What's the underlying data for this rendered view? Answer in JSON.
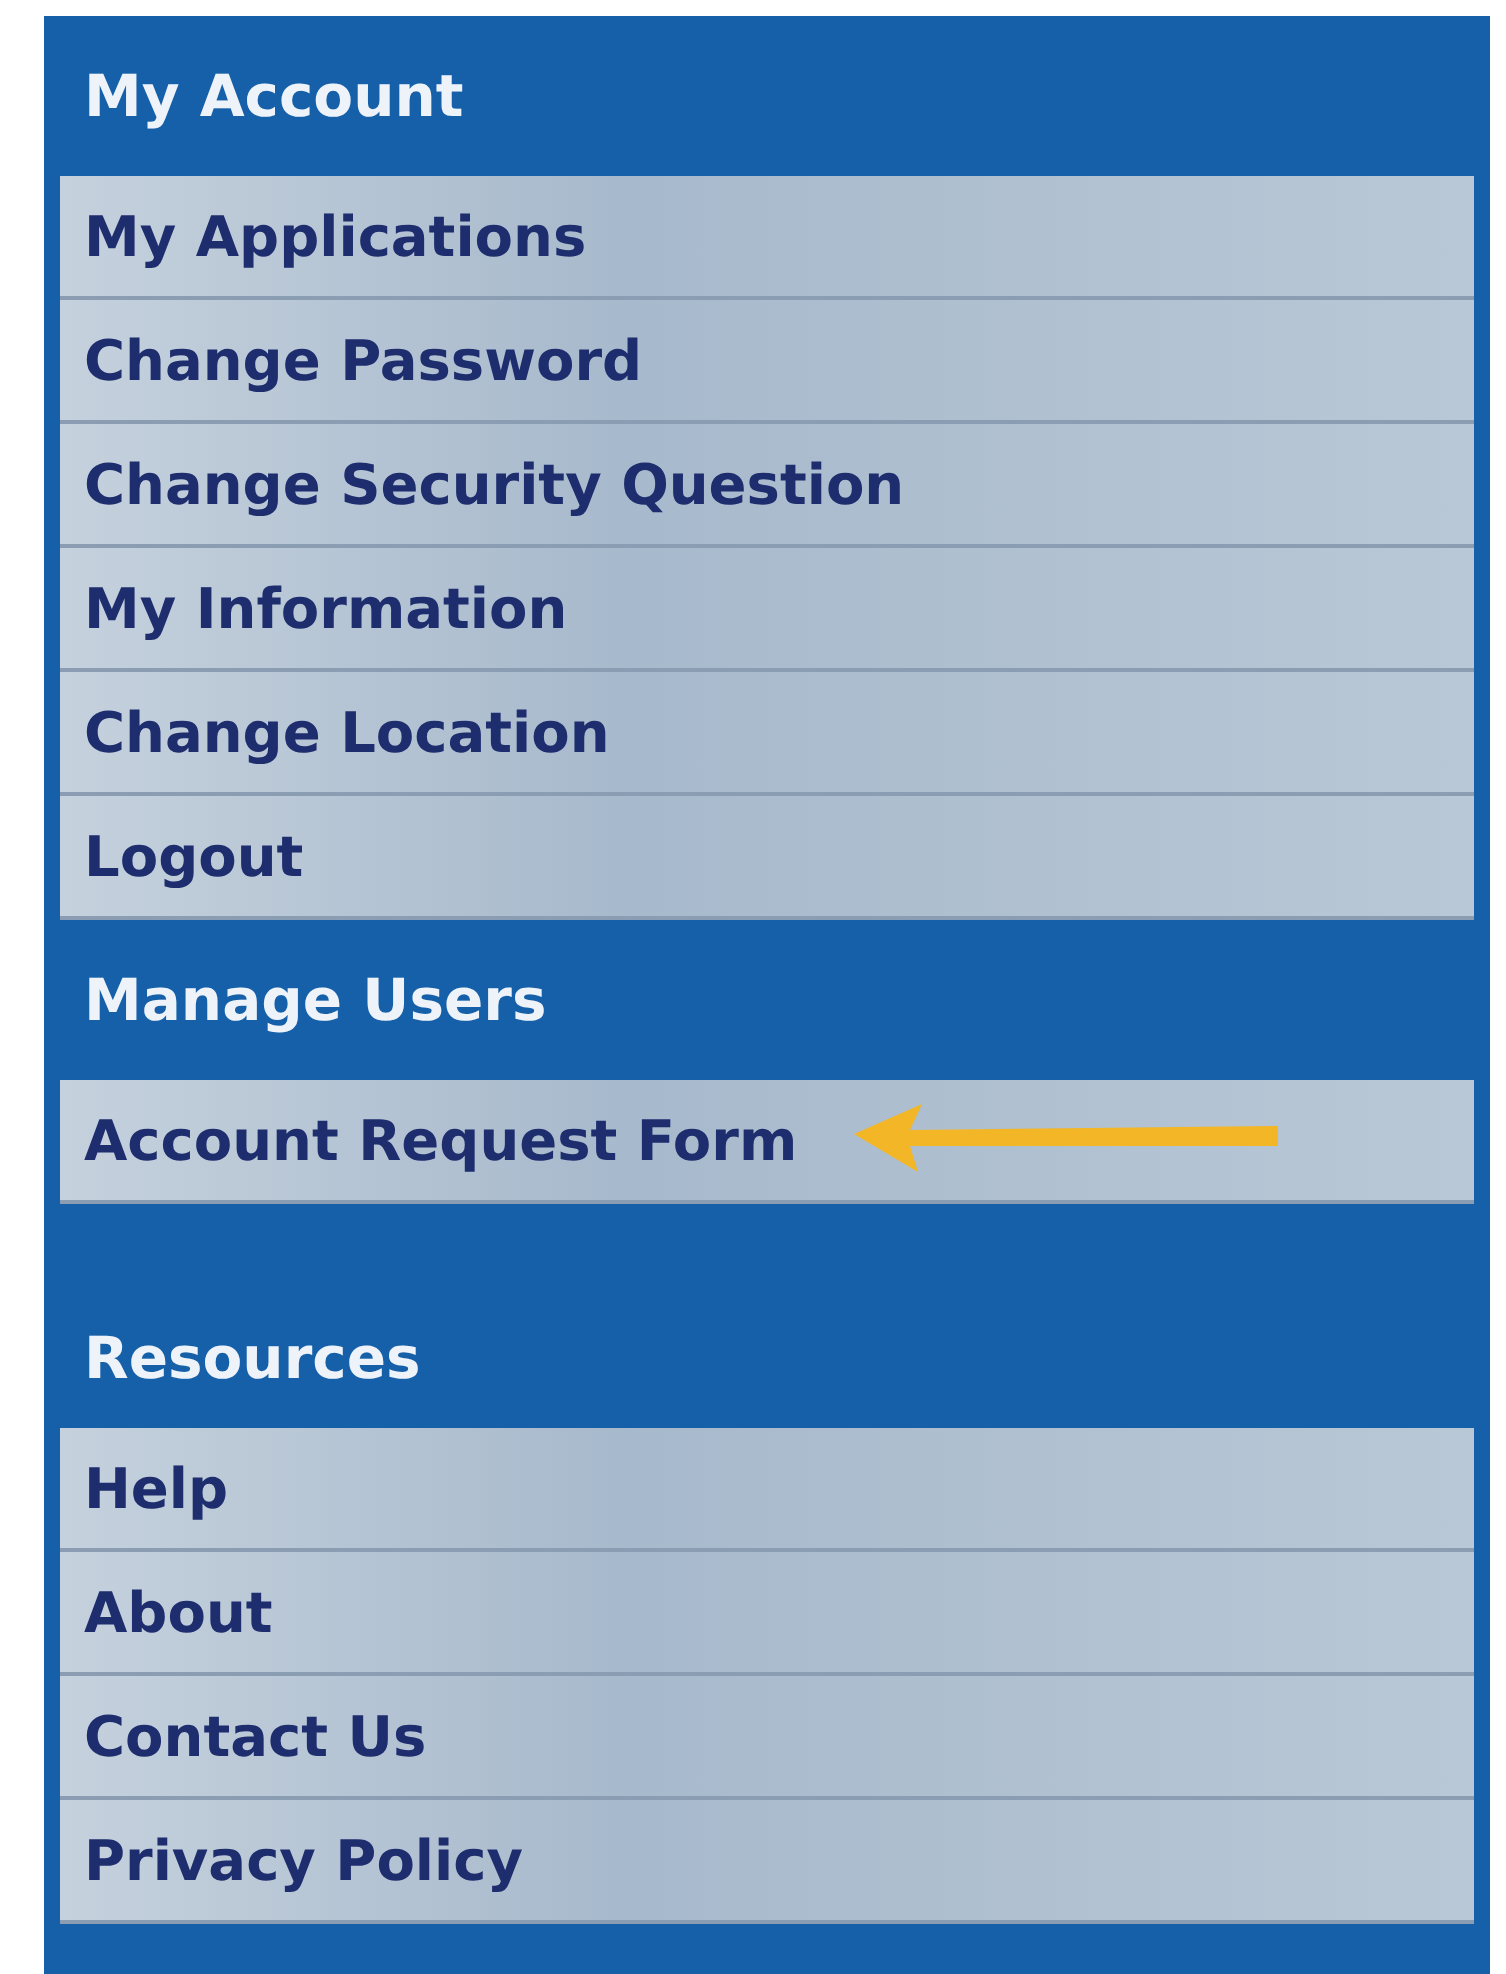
{
  "sections": [
    {
      "title": "My Account",
      "items": [
        {
          "label": "My Applications",
          "arrow": false
        },
        {
          "label": "Change Password",
          "arrow": false
        },
        {
          "label": "Change Security Question",
          "arrow": false
        },
        {
          "label": "My Information",
          "arrow": false
        },
        {
          "label": "Change Location",
          "arrow": false
        },
        {
          "label": "Logout",
          "arrow": false
        }
      ]
    },
    {
      "title": "Manage Users",
      "items": [
        {
          "label": "Account Request Form",
          "arrow": true
        }
      ]
    },
    {
      "title": "Resources",
      "items": [
        {
          "label": "Help",
          "arrow": false
        },
        {
          "label": "About",
          "arrow": false
        },
        {
          "label": "Contact Us",
          "arrow": false
        },
        {
          "label": "Privacy Policy",
          "arrow": false
        }
      ]
    }
  ]
}
